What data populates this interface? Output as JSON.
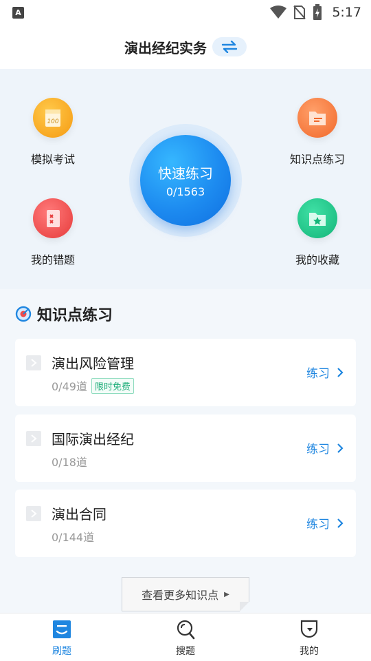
{
  "statusbar": {
    "app_icon_letter": "A",
    "time": "5:17"
  },
  "header": {
    "title": "演出经纪实务",
    "switch_icon": "swap-arrows-icon"
  },
  "features": {
    "mock_exam": {
      "label": "模拟考试",
      "icon": "score-sheet-icon"
    },
    "knowledge_practice": {
      "label": "知识点练习",
      "icon": "folder-doc-icon"
    },
    "wrong_questions": {
      "label": "我的错题",
      "icon": "wrong-notebook-icon"
    },
    "favorites": {
      "label": "我的收藏",
      "icon": "star-folder-icon"
    },
    "quick_practice": {
      "label": "快速练习",
      "progress": "0/1563"
    }
  },
  "section": {
    "title": "知识点练习",
    "icon": "target-icon"
  },
  "cards": [
    {
      "title": "演出风险管理",
      "count": "0/49道",
      "badge": "限时免费",
      "action": "练习"
    },
    {
      "title": "国际演出经纪",
      "count": "0/18道",
      "action": "练习"
    },
    {
      "title": "演出合同",
      "count": "0/144道",
      "action": "练习"
    }
  ],
  "more_button": {
    "label": "查看更多知识点"
  },
  "tabbar": {
    "tabs": [
      {
        "label": "刷题",
        "icon": "practice-icon",
        "active": true
      },
      {
        "label": "搜题",
        "icon": "search-icon",
        "active": false
      },
      {
        "label": "我的",
        "icon": "profile-icon",
        "active": false
      }
    ]
  },
  "colors": {
    "accent": "#1f86e0",
    "badge_green": "#1fae7a",
    "orange": "#f7a51f",
    "red": "#ef4b4b",
    "green": "#1dc98a"
  }
}
